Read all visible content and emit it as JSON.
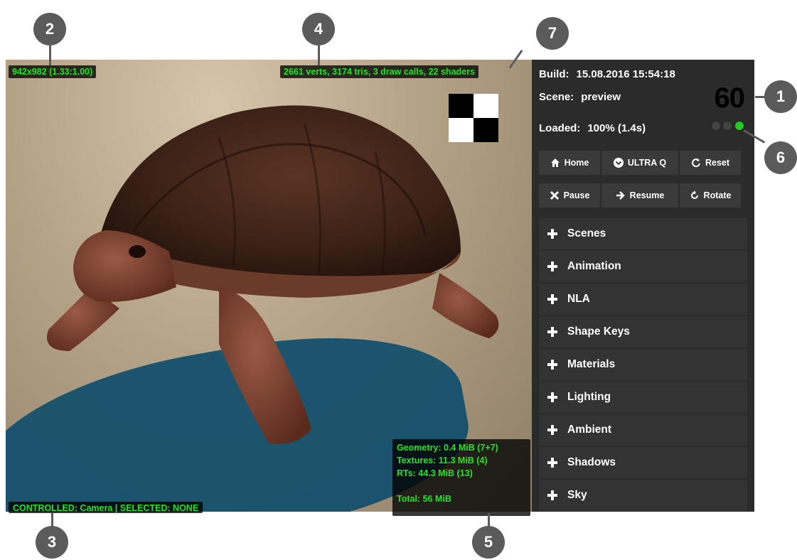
{
  "viewport": {
    "resolution_text": "942x982 (1.33:1.00)",
    "stats_text": "2661 verts, 3174 tris, 3 draw calls, 22 shaders",
    "controlled_text": "CONTROLLED: Camera | SELECTED: NONE",
    "memory": {
      "geometry": "Geometry: 0.4 MiB (7+7)",
      "textures": "Textures: 11.3 MiB (4)",
      "rts": "RTs: 44.3 MiB (13)",
      "total": "Total: 56 MiB"
    }
  },
  "panel": {
    "build_label": "Build:",
    "build_value": "15.08.2016 15:54:18",
    "scene_label": "Scene:",
    "scene_value": "preview",
    "loaded_label": "Loaded:",
    "loaded_value": "100% (1.4s)",
    "fps": "60",
    "buttons_row1": [
      {
        "label": "Home",
        "icon": "home-icon"
      },
      {
        "label": "ULTRA Q",
        "icon": "chevron-down-icon"
      },
      {
        "label": "Reset",
        "icon": "reset-icon"
      }
    ],
    "buttons_row2": [
      {
        "label": "Pause",
        "icon": "close-icon"
      },
      {
        "label": "Resume",
        "icon": "arrow-right-icon"
      },
      {
        "label": "Rotate",
        "icon": "rotate-icon"
      }
    ],
    "sections": [
      "Scenes",
      "Animation",
      "NLA",
      "Shape Keys",
      "Materials",
      "Lighting",
      "Ambient",
      "Shadows",
      "Sky"
    ]
  },
  "callouts": [
    "1",
    "2",
    "3",
    "4",
    "5",
    "6",
    "7"
  ],
  "colors": {
    "hud_text": "#22e622",
    "panel_bg": "#2b2b2b",
    "callout": "#5b5b5b"
  }
}
